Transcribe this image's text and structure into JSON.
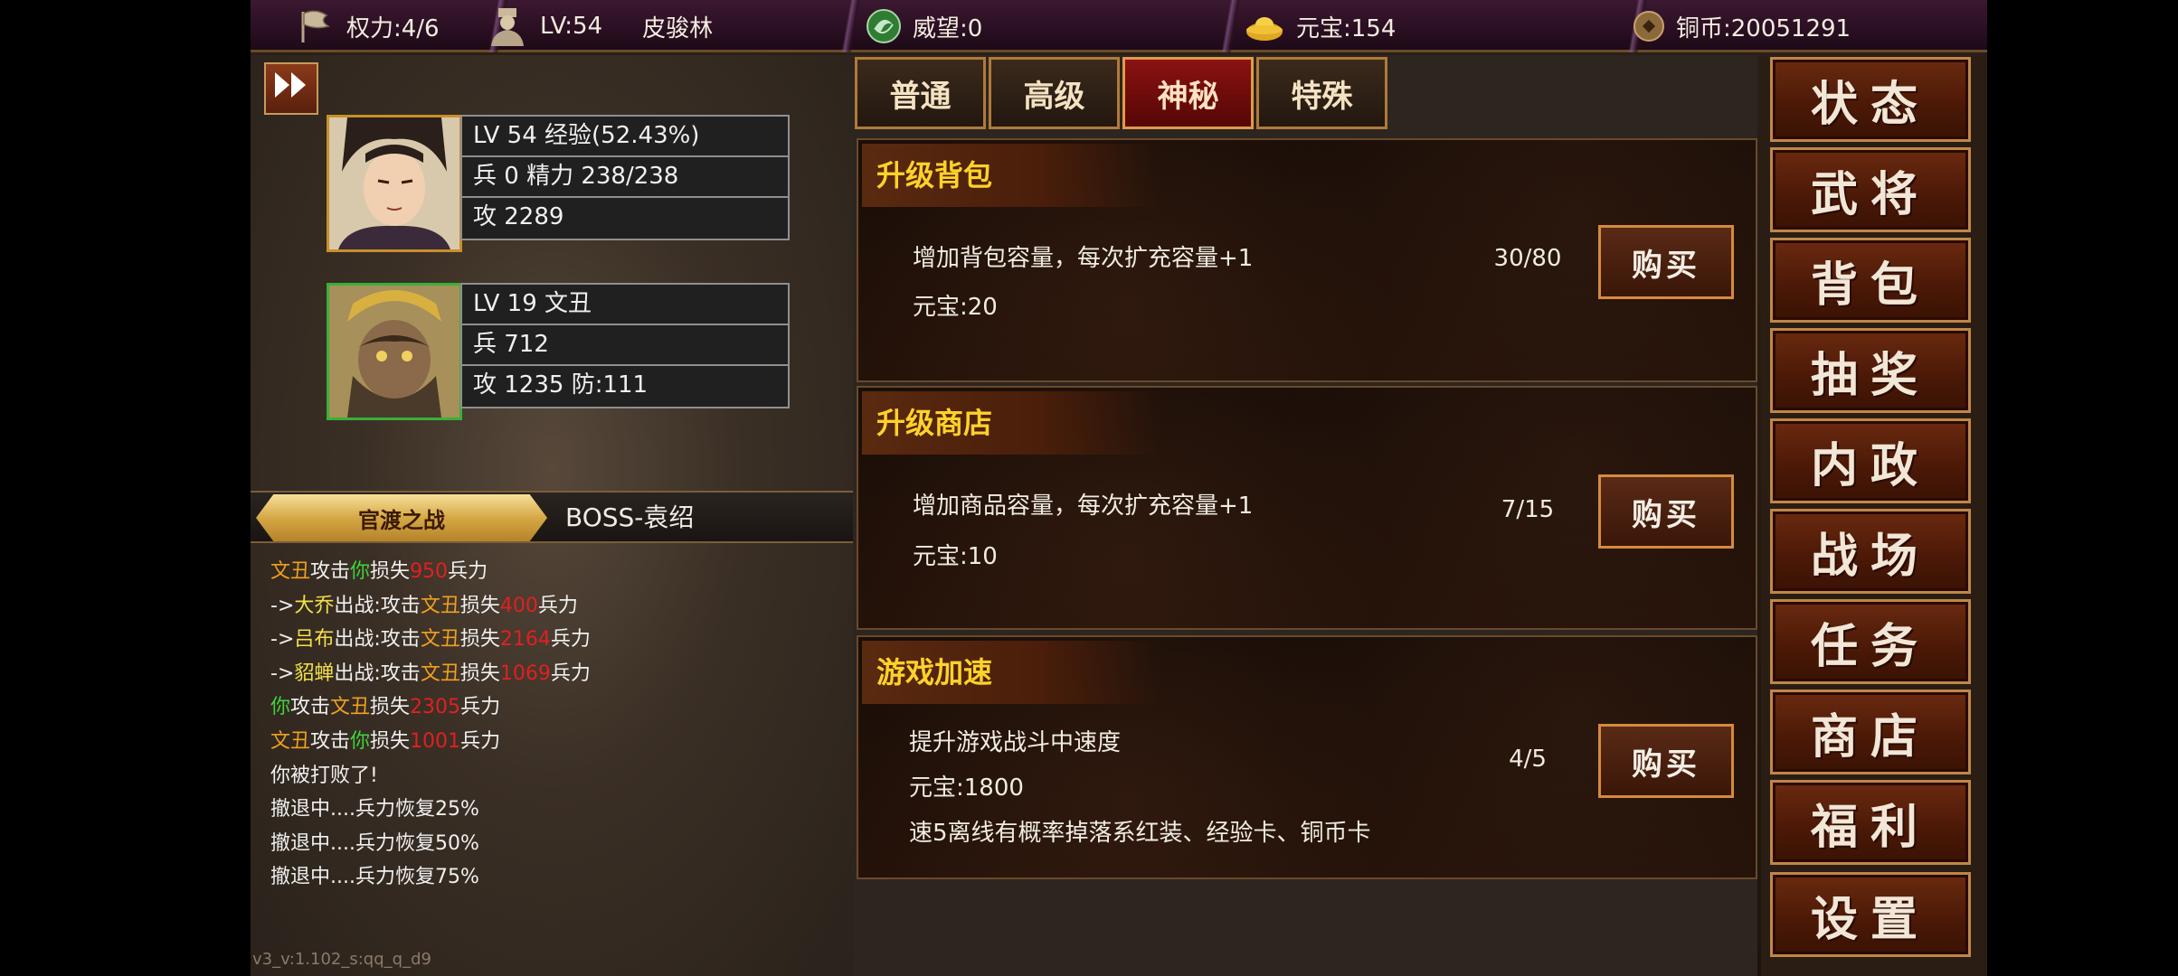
{
  "topbar": {
    "power": "权力:4/6",
    "level": "LV:54",
    "player_name": "皮骏林",
    "prestige": "威望:0",
    "yuanbao": "元宝:154",
    "copper": "铜币:20051291"
  },
  "heroes": [
    {
      "line1": "LV 54 经验(52.43%)",
      "line2": "兵 0 精力 238/238",
      "line3": "攻 2289",
      "frame_color": "#c8902a"
    },
    {
      "line1": "LV 19  文丑",
      "line2": "兵 712",
      "line3": "攻 1235 防:111",
      "frame_color": "#38b038"
    }
  ],
  "battle": {
    "tab": "官渡之战",
    "boss": "BOSS-袁绍",
    "log": [
      [
        [
          "文丑",
          "or"
        ],
        [
          "攻击",
          ""
        ],
        [
          "你",
          "gr"
        ],
        [
          "损失",
          ""
        ],
        [
          "950",
          "rd"
        ],
        [
          "兵力",
          ""
        ]
      ],
      [
        [
          "->",
          ""
        ],
        [
          "大乔",
          "yw"
        ],
        [
          "出战:攻击",
          ""
        ],
        [
          "文丑",
          "or"
        ],
        [
          "损失",
          ""
        ],
        [
          "400",
          "rd"
        ],
        [
          "兵力",
          ""
        ]
      ],
      [
        [
          "->",
          ""
        ],
        [
          "吕布",
          "yw"
        ],
        [
          "出战:攻击",
          ""
        ],
        [
          "文丑",
          "or"
        ],
        [
          "损失",
          ""
        ],
        [
          "2164",
          "rd"
        ],
        [
          "兵力",
          ""
        ]
      ],
      [
        [
          "->",
          ""
        ],
        [
          "貂蝉",
          "yw"
        ],
        [
          "出战:攻击",
          ""
        ],
        [
          "文丑",
          "or"
        ],
        [
          "损失",
          ""
        ],
        [
          "1069",
          "rd"
        ],
        [
          "兵力",
          ""
        ]
      ],
      [
        [
          "你",
          "gr"
        ],
        [
          "攻击",
          ""
        ],
        [
          "文丑",
          "or"
        ],
        [
          "损失",
          ""
        ],
        [
          "2305",
          "rd"
        ],
        [
          "兵力",
          ""
        ]
      ],
      [
        [
          "文丑",
          "or"
        ],
        [
          "攻击",
          ""
        ],
        [
          "你",
          "gr"
        ],
        [
          "损失",
          ""
        ],
        [
          "1001",
          "rd"
        ],
        [
          "兵力",
          ""
        ]
      ],
      [
        [
          "你被打败了!",
          ""
        ]
      ],
      [
        [
          "撤退中....兵力恢复25%",
          ""
        ]
      ],
      [
        [
          "撤退中....兵力恢复50%",
          ""
        ]
      ],
      [
        [
          "撤退中....兵力恢复75%",
          ""
        ]
      ]
    ],
    "version": "v3_v:1.102_s:qq_q_d9"
  },
  "tabs": [
    {
      "label": "普通",
      "active": false
    },
    {
      "label": "高级",
      "active": false
    },
    {
      "label": "神秘",
      "active": true
    },
    {
      "label": "特殊",
      "active": false
    }
  ],
  "items": [
    {
      "title": "升级背包",
      "desc": "增加背包容量，每次扩充容量+1",
      "price": "元宝:20",
      "count": "30/80",
      "buy": "购买"
    },
    {
      "title": "升级商店",
      "desc": "增加商品容量，每次扩充容量+1",
      "price": "元宝:10",
      "count": "7/15",
      "buy": "购买"
    },
    {
      "title": "游戏加速",
      "desc": "提升游戏战斗中速度",
      "price": "元宝:1800",
      "note": "速5离线有概率掉落系红装、经验卡、铜币卡",
      "count": "4/5",
      "buy": "购买"
    }
  ],
  "menu": [
    "状态",
    "武将",
    "背包",
    "抽奖",
    "内政",
    "战场",
    "任务",
    "商店",
    "福利",
    "设置"
  ],
  "icons": {
    "power": "flag-icon",
    "level": "general-icon",
    "prestige": "prestige-icon",
    "yuanbao": "gold-ingot-icon",
    "copper": "copper-coin-icon",
    "fast_forward": "fast-forward-icon"
  }
}
